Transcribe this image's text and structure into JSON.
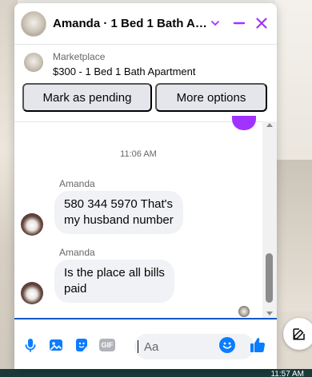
{
  "colors": {
    "accent": "#a033ff",
    "messenger_blue": "#0a7cff",
    "bubble_bg": "#f0f2f5",
    "secondary_text": "#65676b"
  },
  "header": {
    "title": "Amanda · 1 Bed 1 Bath Apartment",
    "chevron_icon": "chevron-down-icon",
    "minimize_icon": "minimize-icon",
    "close_icon": "close-icon"
  },
  "listing": {
    "source": "Marketplace",
    "title": "$300 - 1 Bed 1 Bath Apartment",
    "mark_pending_label": "Mark as pending",
    "more_options_label": "More options"
  },
  "conversation": {
    "timestamp": "11:06 AM",
    "messages": [
      {
        "sender": "Amanda",
        "text_line1": "580 344 5970 That's",
        "text_line2": "my husband number"
      },
      {
        "sender": "Amanda",
        "text_line1": "Is the place all bills",
        "text_line2": "paid"
      }
    ]
  },
  "composer": {
    "placeholder": "Aa",
    "icons": [
      "microphone-icon",
      "photo-icon",
      "sticker-icon",
      "gif-icon",
      "emoji-icon",
      "thumbs-up-icon"
    ],
    "gif_label": "GIF"
  },
  "taskbar": {
    "time": "11:57 AM"
  }
}
